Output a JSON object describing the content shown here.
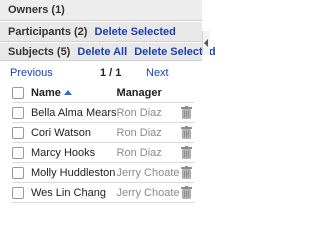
{
  "owners": {
    "label": "Owners (1)"
  },
  "participants": {
    "label": "Participants (2)",
    "delete_selected": "Delete Selected"
  },
  "subjects": {
    "label": "Subjects (5)",
    "delete_all": "Delete All",
    "delete_selected": "Delete Selected"
  },
  "pager": {
    "previous": "Previous",
    "page": "1 / 1",
    "next": "Next"
  },
  "table": {
    "columns": {
      "name": "Name",
      "manager": "Manager"
    },
    "rows": [
      {
        "name": "Bella Alma Mears",
        "manager": "Ron Diaz"
      },
      {
        "name": "Cori Watson",
        "manager": "Ron Diaz"
      },
      {
        "name": "Marcy Hooks",
        "manager": "Ron Diaz"
      },
      {
        "name": "Molly Huddleston",
        "manager": "Jerry Choate"
      },
      {
        "name": "Wes Lin Chang",
        "manager": "Jerry Choate"
      }
    ]
  },
  "colors": {
    "link": "#1a3fb5",
    "header_bg": "#e8e8e8",
    "muted_text": "#8a8a8a"
  },
  "icons": {
    "row_action": "trash-icon",
    "sort": "sort-ascending-icon",
    "collapse": "chevron-left-icon"
  }
}
